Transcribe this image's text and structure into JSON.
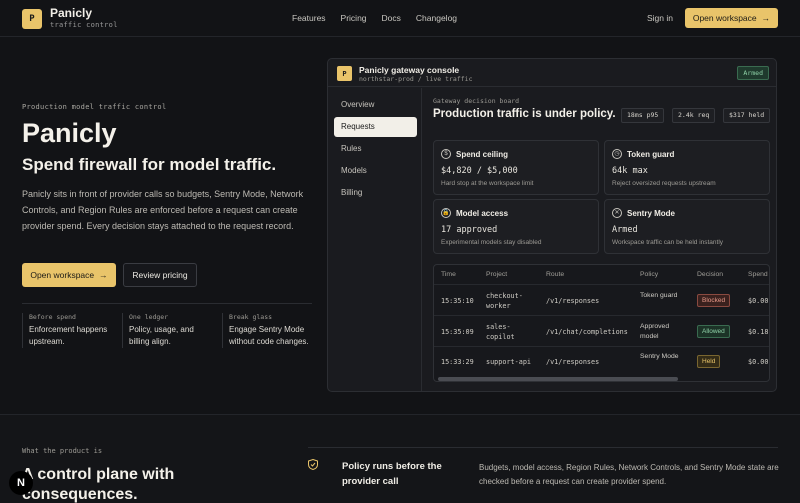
{
  "nav": {
    "brand": "Panicly",
    "brand_sub": "traffic control",
    "logo_letter": "P",
    "links": [
      "Features",
      "Pricing",
      "Docs",
      "Changelog"
    ],
    "signin": "Sign in",
    "cta": "Open workspace",
    "accent": "#e9c46a"
  },
  "hero": {
    "eyebrow": "Production model traffic control",
    "title": "Panicly",
    "subtitle": "Spend firewall for model traffic.",
    "description": "Panicly sits in front of provider calls so budgets, Sentry Mode, Network Controls, and Region Rules are enforced before a request can create provider spend. Every decision stays attached to the request record.",
    "primary_cta": "Open workspace",
    "secondary_cta": "Review pricing",
    "features": [
      {
        "label": "Before spend",
        "text": "Enforcement happens upstream."
      },
      {
        "label": "One ledger",
        "text": "Policy, usage, and billing align."
      },
      {
        "label": "Break glass",
        "text": "Engage Sentry Mode without code changes."
      }
    ]
  },
  "console": {
    "logo_letter": "P",
    "title": "Panicly gateway console",
    "subtitle": "northstar-prod / live traffic",
    "status": "Armed",
    "sidebar": [
      "Overview",
      "Requests",
      "Rules",
      "Models",
      "Billing"
    ],
    "board_label": "Gateway decision board",
    "board_title": "Production traffic is under policy.",
    "pills": [
      "18ms p95",
      "2.4k req",
      "$317 held"
    ],
    "cards": [
      {
        "icon": "$",
        "title": "Spend ceiling",
        "value": "$4,820 / $5,000",
        "note": "Hard stop at the workspace limit"
      },
      {
        "icon": "◷",
        "title": "Token guard",
        "value": "64k max",
        "note": "Reject oversized requests upstream"
      },
      {
        "icon": "🔒",
        "title": "Model access",
        "value": "17 approved",
        "note": "Experimental models stay disabled"
      },
      {
        "icon": "✕",
        "title": "Sentry Mode",
        "value": "Armed",
        "note": "Workspace traffic can be held instantly"
      }
    ],
    "table": {
      "headers": [
        "Time",
        "Project",
        "Route",
        "Policy",
        "Decision",
        "Spend"
      ],
      "rows": [
        {
          "time": "15:35:10",
          "project": "checkout-worker",
          "route": "/v1/responses",
          "policy": "Token guard",
          "decision": "Blocked",
          "spend": "$0.00"
        },
        {
          "time": "15:35:09",
          "project": "sales-copilot",
          "route": "/v1/chat/completions",
          "policy": "Approved model",
          "decision": "Allowed",
          "spend": "$0.18"
        },
        {
          "time": "15:33:29",
          "project": "support-api",
          "route": "/v1/responses",
          "policy": "Sentry Mode",
          "decision": "Held",
          "spend": "$0.00"
        }
      ]
    }
  },
  "section": {
    "eyebrow": "What the product is",
    "title": "A control plane with consequences.",
    "feature_title": "Policy runs before the provider call",
    "feature_text": "Budgets, model access, Region Rules, Network Controls, and Sentry Mode state are checked before a request can create provider spend."
  },
  "n_badge": "N"
}
